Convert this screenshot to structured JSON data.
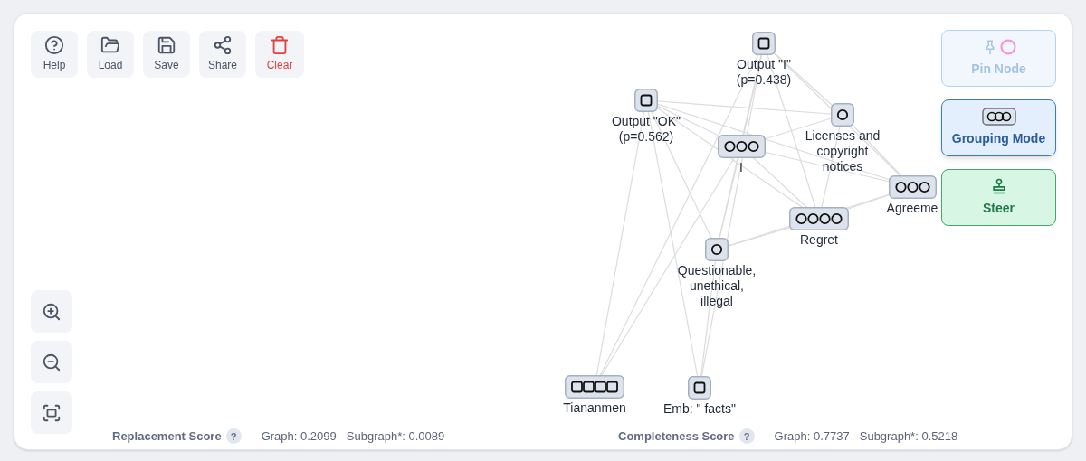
{
  "toolbar": [
    {
      "kind": "help",
      "label": "Help"
    },
    {
      "kind": "load",
      "label": "Load"
    },
    {
      "kind": "save",
      "label": "Save"
    },
    {
      "kind": "share",
      "label": "Share"
    },
    {
      "kind": "clear",
      "label": "Clear"
    }
  ],
  "graph": {
    "nodes": [
      {
        "kind": "square",
        "label": "Output \"I\"\n(p=0.438)"
      },
      {
        "kind": "square",
        "label": "Output \"OK\"\n(p=0.562)"
      },
      {
        "kind": "triple",
        "label": "I"
      },
      {
        "kind": "circle",
        "label": "Licenses and\ncopyright\nnotices"
      },
      {
        "kind": "triple",
        "label": "Agreeme"
      },
      {
        "kind": "quad",
        "label": "Regret"
      },
      {
        "kind": "circle",
        "label": "Questionable,\nunethical,\nillegal"
      },
      {
        "kind": "squares",
        "label": "Tiananmen"
      },
      {
        "kind": "square",
        "label": "Emb: \" facts\""
      }
    ]
  },
  "modes": [
    {
      "kind": "pin",
      "label": "Pin Node",
      "disabled": true,
      "selected": false
    },
    {
      "kind": "group",
      "label": "Grouping Mode",
      "disabled": false,
      "selected": true
    },
    {
      "kind": "steer",
      "label": "Steer",
      "disabled": false,
      "selected": false
    }
  ],
  "zoom_controls": [
    {
      "kind": "zoom_in"
    },
    {
      "kind": "zoom_out"
    },
    {
      "kind": "fit"
    }
  ],
  "scores": [
    {
      "title": "Replacement Score",
      "help": "?",
      "graph": "Graph: 0.2099",
      "subgraph": "Subgraph*: 0.0089"
    },
    {
      "title": "Completeness Score",
      "help": "?",
      "graph": "Graph: 0.7737",
      "subgraph": "Subgraph*: 0.5218"
    }
  ]
}
